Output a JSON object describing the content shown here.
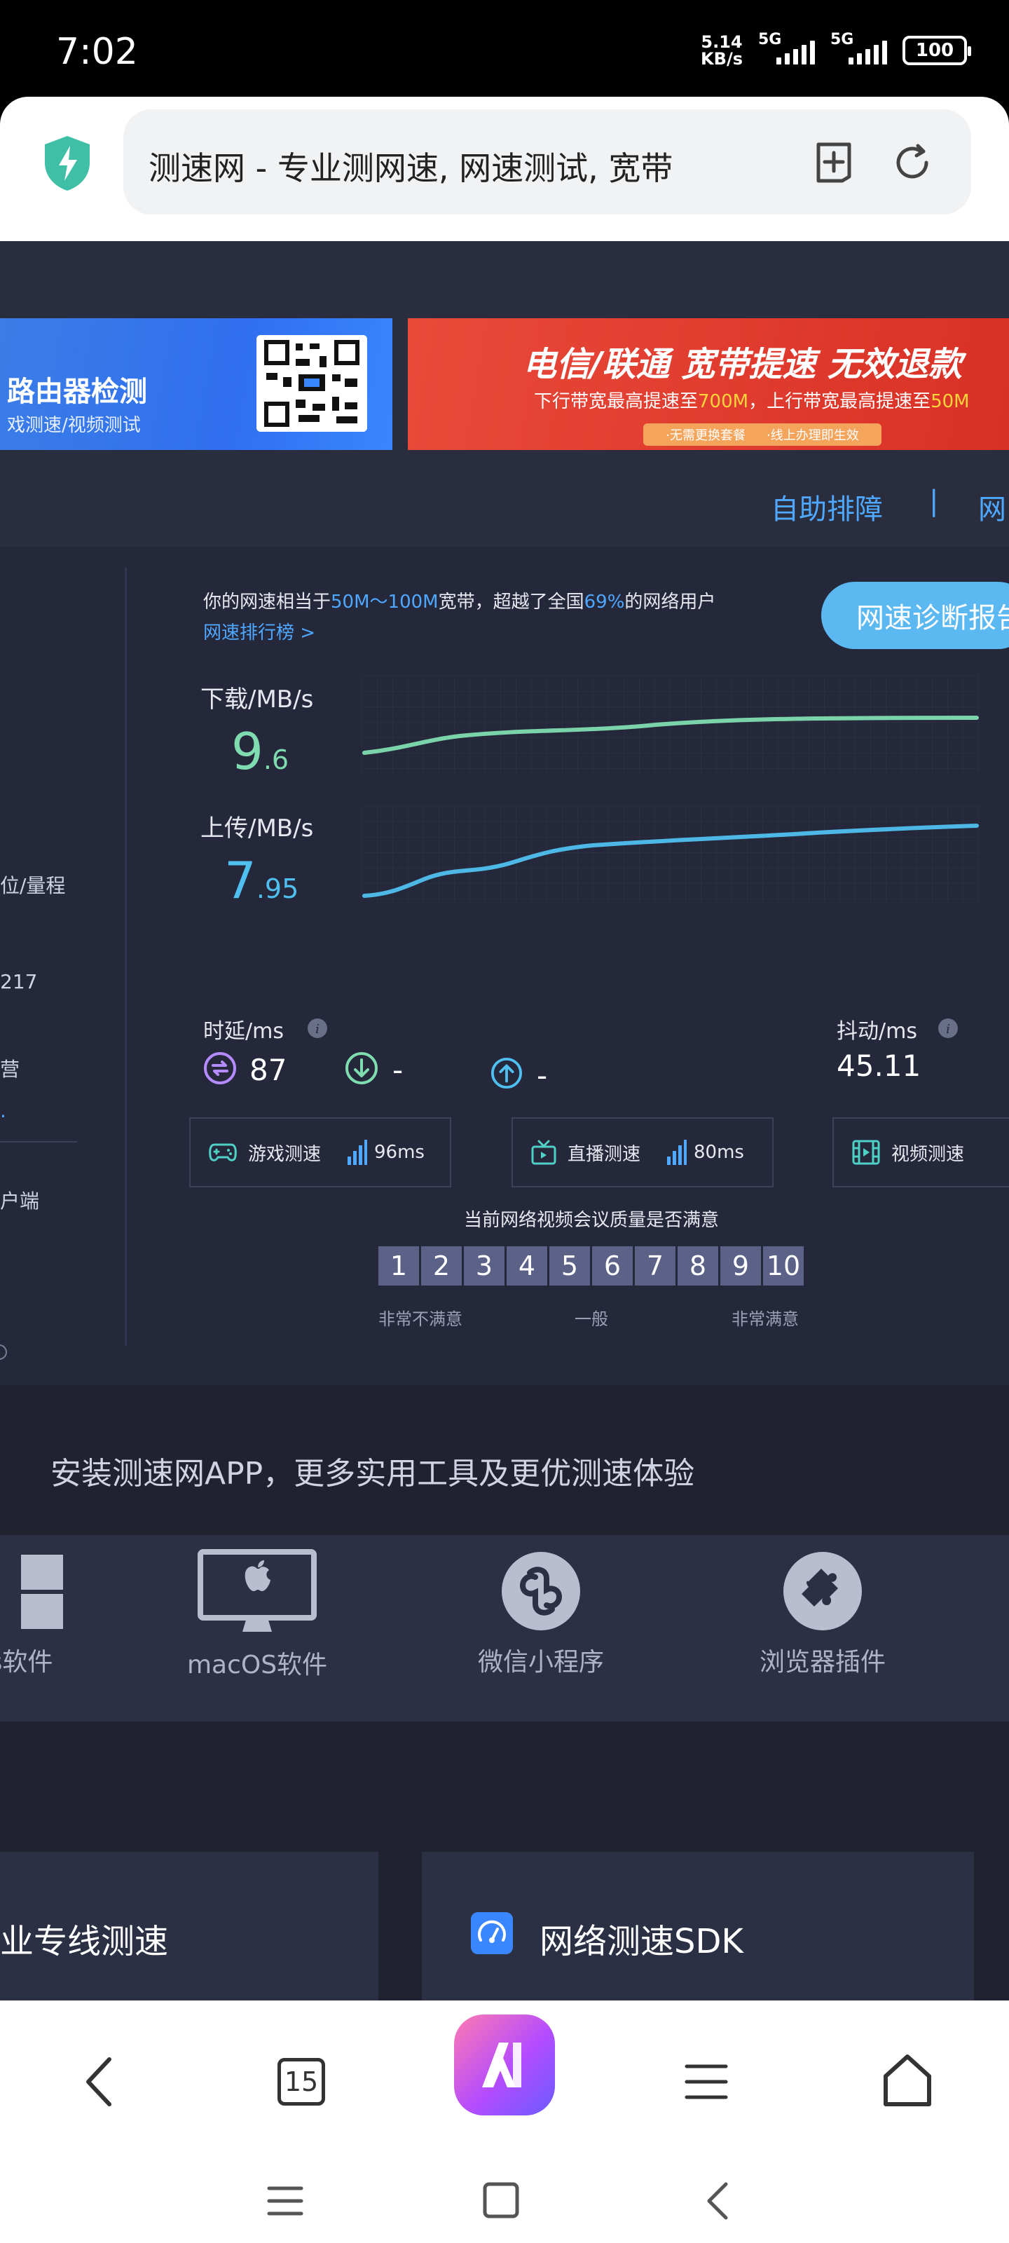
{
  "status_bar": {
    "time": "7:02",
    "speed_value": "5.14",
    "speed_unit": "KB/s",
    "sim1": "5G",
    "sim2": "5G",
    "battery": "100"
  },
  "browser": {
    "url_title": "测速网 - 专业测网速, 网速测试, 宽带",
    "icons": [
      "shield-icon",
      "add-tab-icon",
      "refresh-icon"
    ]
  },
  "ads": {
    "left_title": "路由器检测",
    "left_sub": "戏测速/视频测试",
    "right_title": "电信/联通 宽带提速 无效退款",
    "right_sub_a": "下行带宽最高提速至",
    "right_sub_a_val": "700M",
    "right_sub_b": "，上行带宽最高提速至",
    "right_sub_b_val": "50M",
    "right_pill_1": "·无需更换套餐",
    "right_pill_2": "·线上办理即生效"
  },
  "nav": {
    "help": "自助排障",
    "sep": "|",
    "more": "网"
  },
  "left_fragments": [
    "位/量程",
    "217",
    "营",
    "·",
    "户端"
  ],
  "result": {
    "summary_a": "你的网速相当于",
    "summary_range": "50M～100M",
    "summary_b": "宽带，超越了全国",
    "summary_pct": "69%",
    "summary_c": "的网络用户",
    "rank_link": "网速排行榜 >",
    "diag_button": "网速诊断报告"
  },
  "download": {
    "label": "下载/MB/s",
    "int": "9",
    "dec": ".6"
  },
  "upload": {
    "label": "上传/MB/s",
    "int": "7",
    "dec": ".95"
  },
  "latency": {
    "label": "时延/ms",
    "value": "87",
    "down": "-",
    "up": "-"
  },
  "jitter": {
    "label": "抖动/ms",
    "value": "45.11"
  },
  "tests": [
    {
      "label": "游戏测速",
      "ping": "96ms"
    },
    {
      "label": "直播测速",
      "ping": "80ms"
    },
    {
      "label": "视频测速"
    }
  ],
  "rating": {
    "question": "当前网络视频会议质量是否满意",
    "scale": [
      "1",
      "2",
      "3",
      "4",
      "5",
      "6",
      "7",
      "8",
      "9",
      "10"
    ],
    "low": "非常不满意",
    "mid": "一般",
    "high": "非常满意"
  },
  "promo": "安装测速网APP，更多实用工具及更优测速体验",
  "apps": [
    "s软件",
    "macOS软件",
    "微信小程序",
    "浏览器插件"
  ],
  "cards": {
    "leased": "业专线测速",
    "sdk": "网络测速SDK"
  },
  "toolbar": {
    "tabs_count": "15"
  },
  "colors": {
    "page_bg": "#20222f",
    "panel_bg": "#25283a",
    "accent_blue": "#4fa8ff",
    "download_green": "#7fdcb0",
    "upload_cyan": "#4fbfef",
    "ad_red": "#d93025"
  }
}
